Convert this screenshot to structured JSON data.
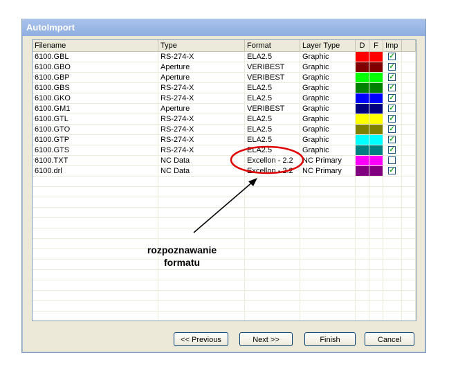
{
  "window": {
    "title": "AutoImport"
  },
  "columns": [
    "Filename",
    "Type",
    "Format",
    "Layer Type",
    "D",
    "F",
    "Imp"
  ],
  "rows": [
    {
      "file": "6100.GBL",
      "type": "RS-274-X",
      "format": "ELA2.5",
      "layer": "Graphic",
      "color": "#ff0000",
      "imp": true
    },
    {
      "file": "6100.GBO",
      "type": "Aperture",
      "format": "VERIBEST",
      "layer": "Graphic",
      "color": "#800000",
      "imp": true
    },
    {
      "file": "6100.GBP",
      "type": "Aperture",
      "format": "VERIBEST",
      "layer": "Graphic",
      "color": "#00ff00",
      "imp": true
    },
    {
      "file": "6100.GBS",
      "type": "RS-274-X",
      "format": "ELA2.5",
      "layer": "Graphic",
      "color": "#008000",
      "imp": true
    },
    {
      "file": "6100.GKO",
      "type": "RS-274-X",
      "format": "ELA2.5",
      "layer": "Graphic",
      "color": "#0000ff",
      "imp": true
    },
    {
      "file": "6100.GM1",
      "type": "Aperture",
      "format": "VERIBEST",
      "layer": "Graphic",
      "color": "#000080",
      "imp": true
    },
    {
      "file": "6100.GTL",
      "type": "RS-274-X",
      "format": "ELA2.5",
      "layer": "Graphic",
      "color": "#ffff00",
      "imp": true
    },
    {
      "file": "6100.GTO",
      "type": "RS-274-X",
      "format": "ELA2.5",
      "layer": "Graphic",
      "color": "#808000",
      "imp": true
    },
    {
      "file": "6100.GTP",
      "type": "RS-274-X",
      "format": "ELA2.5",
      "layer": "Graphic",
      "color": "#00ffff",
      "imp": true
    },
    {
      "file": "6100.GTS",
      "type": "RS-274-X",
      "format": "ELA2.5",
      "layer": "Graphic",
      "color": "#008080",
      "imp": true
    },
    {
      "file": "6100.TXT",
      "type": "NC Data",
      "format": "Excellon - 2.2",
      "layer": "NC Primary",
      "color": "#ff00ff",
      "imp": false
    },
    {
      "file": "6100.drl",
      "type": "NC Data",
      "format": "Excellon - 2.2",
      "layer": "NC Primary",
      "color": "#800080",
      "imp": true
    }
  ],
  "buttons": {
    "previous": "<< Previous",
    "next": "Next >>",
    "finish": "Finish",
    "cancel": "Cancel"
  },
  "annotation": {
    "line1": "rozpoznawanie",
    "line2": "formatu",
    "color": "#e00000"
  }
}
